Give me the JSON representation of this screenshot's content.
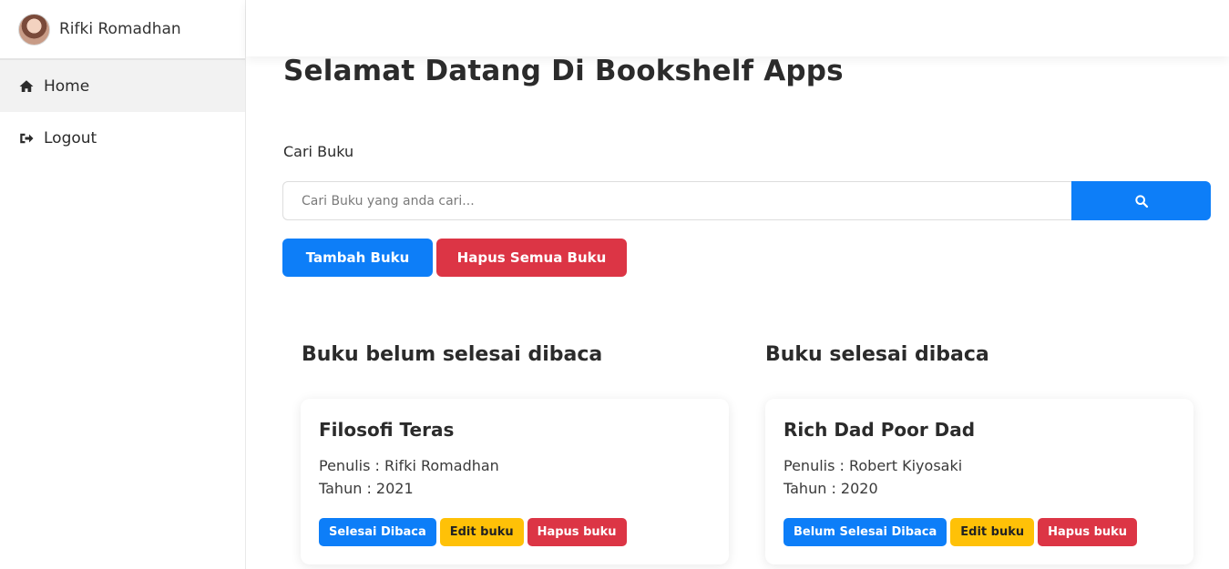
{
  "profile": {
    "name": "Rifki Romadhan"
  },
  "sidebar": {
    "items": [
      {
        "label": "Home",
        "icon": "home-icon",
        "active": true
      },
      {
        "label": "Logout",
        "icon": "logout-icon",
        "active": false
      }
    ]
  },
  "main": {
    "title": "Selamat Datang Di Bookshelf Apps",
    "search": {
      "label": "Cari Buku",
      "placeholder": "Cari Buku yang anda cari...",
      "value": "",
      "button_icon": "search-icon"
    },
    "actions": {
      "add_label": "Tambah Buku",
      "delete_all_label": "Hapus Semua Buku"
    },
    "unread": {
      "title": "Buku belum selesai dibaca",
      "books": [
        {
          "title": "Filosofi Teras",
          "author_line": "Penulis : Rifki Romadhan",
          "year_line": "Tahun : 2021",
          "toggle_label": "Selesai Dibaca",
          "edit_label": "Edit buku",
          "delete_label": "Hapus buku"
        }
      ]
    },
    "read": {
      "title": "Buku selesai dibaca",
      "books": [
        {
          "title": "Rich Dad Poor Dad",
          "author_line": "Penulis : Robert Kiyosaki",
          "year_line": "Tahun : 2020",
          "toggle_label": "Belum Selesai Dibaca",
          "edit_label": "Edit buku",
          "delete_label": "Hapus buku"
        }
      ]
    }
  },
  "colors": {
    "primary": "#0d7ef8",
    "danger": "#dc3545",
    "warning": "#ffc107",
    "active_nav": "#f2f2f2"
  }
}
